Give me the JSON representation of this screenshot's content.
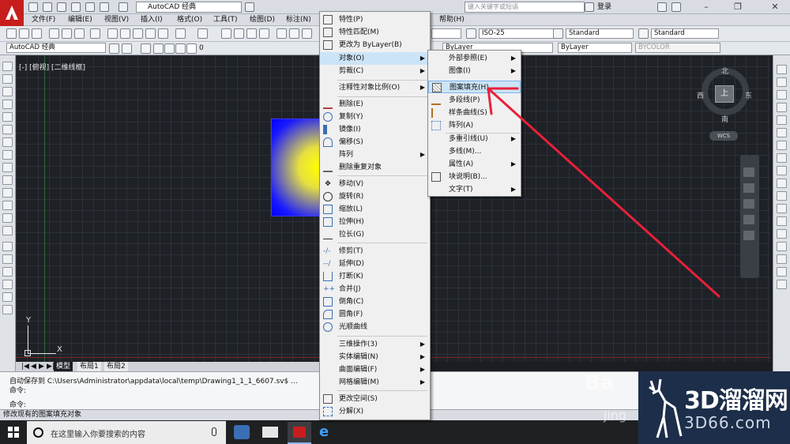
{
  "titlebar": {
    "workspace": "AutoCAD 经典",
    "search_placeholder": "键入关键字或短语",
    "login": "登录"
  },
  "menubar": {
    "items": [
      "文件(F)",
      "编辑(E)",
      "视图(V)",
      "插入(I)",
      "格式(O)",
      "工具(T)",
      "绘图(D)",
      "标注(N)",
      "帮助(H)"
    ]
  },
  "toolbar": {
    "workspace_combo": "AutoCAD 经典",
    "layer_value": "0",
    "dimstyle": "ISO-25",
    "textstyle": "Standard",
    "tablestyle": "Standard",
    "linetype1": "ByLayer",
    "linetype2": "ByLayer",
    "plotstyle": "BYCOLOR"
  },
  "viewport": {
    "label": "[-] [俯视] [二维线框]",
    "cube_top": "上",
    "north": "北",
    "south": "南",
    "west": "西",
    "east": "东",
    "wcs": "WCS",
    "ucs_x": "X",
    "ucs_y": "Y"
  },
  "tabs": [
    "模型",
    "布局1",
    "布局2"
  ],
  "command": {
    "line1": "自动保存到 C:\\Users\\Administrator\\appdata\\local\\temp\\Drawing1_1_1_6607.sv$ ...",
    "line2": "命令:",
    "prompt": "命令:"
  },
  "status_text": "修改现有的图案填充对象",
  "taskbar": {
    "search_placeholder": "在这里输入你要搜索的内容"
  },
  "modify_menu": {
    "items": [
      {
        "label": "特性(P)",
        "submenu": false
      },
      {
        "label": "特性匹配(M)",
        "submenu": false
      },
      {
        "label": "更改为 ByLayer(B)",
        "submenu": false
      },
      {
        "label": "对象(O)",
        "submenu": true
      },
      {
        "label": "剪裁(C)",
        "submenu": true
      },
      {
        "label": "注释性对象比例(O)",
        "submenu": true
      },
      {
        "label": "删除(E)",
        "submenu": false
      },
      {
        "label": "复制(Y)",
        "submenu": false
      },
      {
        "label": "镜像(I)",
        "submenu": false
      },
      {
        "label": "偏移(S)",
        "submenu": false
      },
      {
        "label": "阵列",
        "submenu": true
      },
      {
        "label": "删除重复对象",
        "submenu": false
      },
      {
        "label": "移动(V)",
        "submenu": false
      },
      {
        "label": "旋转(R)",
        "submenu": false
      },
      {
        "label": "缩放(L)",
        "submenu": false
      },
      {
        "label": "拉伸(H)",
        "submenu": false
      },
      {
        "label": "拉长(G)",
        "submenu": false
      },
      {
        "label": "修剪(T)",
        "submenu": false
      },
      {
        "label": "延伸(D)",
        "submenu": false
      },
      {
        "label": "打断(K)",
        "submenu": false
      },
      {
        "label": "合并(J)",
        "submenu": false
      },
      {
        "label": "倒角(C)",
        "submenu": false
      },
      {
        "label": "圆角(F)",
        "submenu": false
      },
      {
        "label": "光顺曲线",
        "submenu": false
      },
      {
        "label": "三维操作(3)",
        "submenu": true
      },
      {
        "label": "实体编辑(N)",
        "submenu": true
      },
      {
        "label": "曲面编辑(F)",
        "submenu": true
      },
      {
        "label": "网格编辑(M)",
        "submenu": true
      },
      {
        "label": "更改空间(S)",
        "submenu": false
      },
      {
        "label": "分解(X)",
        "submenu": false
      }
    ]
  },
  "object_menu": {
    "items": [
      {
        "label": "外部参照(E)",
        "submenu": true
      },
      {
        "label": "图像(I)",
        "submenu": true
      },
      {
        "label": "图案填充(H)...",
        "submenu": false,
        "highlighted": true
      },
      {
        "label": "多段线(P)",
        "submenu": false
      },
      {
        "label": "样条曲线(S)",
        "submenu": false
      },
      {
        "label": "阵列(A)",
        "submenu": false
      },
      {
        "label": "多重引线(U)",
        "submenu": true
      },
      {
        "label": "多线(M)...",
        "submenu": false
      },
      {
        "label": "属性(A)",
        "submenu": true
      },
      {
        "label": "块说明(B)...",
        "submenu": false
      },
      {
        "label": "文字(T)",
        "submenu": true
      }
    ]
  },
  "watermark": {
    "title": "3D溜溜网",
    "url": "3D66.com",
    "partial": "jing"
  },
  "colors": {
    "accent": "#c81d1d",
    "highlight": "#cce4f7",
    "annotation": "#e8203a"
  }
}
